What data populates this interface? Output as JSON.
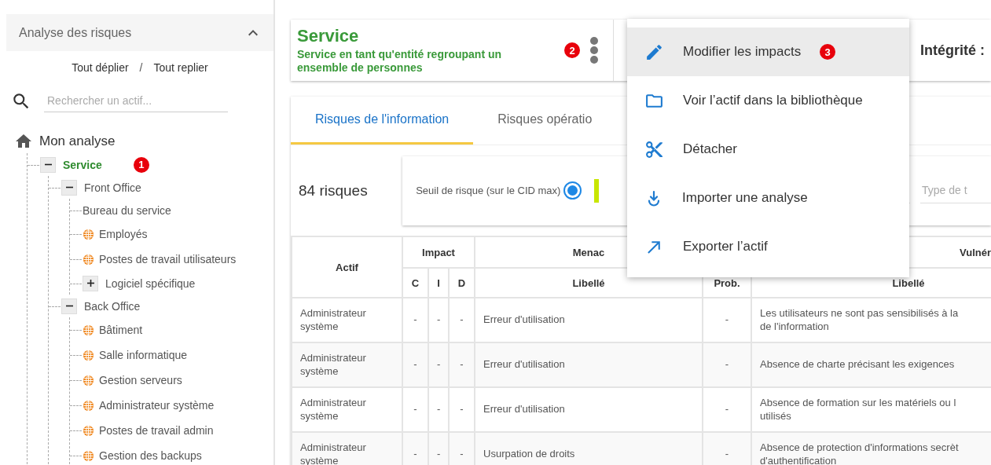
{
  "sidebar": {
    "title": "Analyse des risques",
    "expanded": true,
    "expand_all": "Tout déplier",
    "separator": "/",
    "collapse_all": "Tout replier",
    "search": {
      "placeholder": "Rechercher un actif..."
    },
    "tree": {
      "label": "Mon analyse",
      "children": [
        {
          "label": "Service",
          "kind": "group",
          "expanded": true,
          "selected": true,
          "badge": "1",
          "children": [
            {
              "label": "Front Office",
              "kind": "group",
              "expanded": true,
              "selected": false,
              "children": [
                {
                  "label": "Bureau du service",
                  "kind": "plain",
                  "selected": false
                },
                {
                  "label": "Employés",
                  "kind": "asset",
                  "selected": false
                },
                {
                  "label": "Postes de travail utilisateurs",
                  "kind": "asset",
                  "selected": false
                },
                {
                  "label": "Logiciel spécifique",
                  "kind": "group",
                  "expanded": false,
                  "selected": false
                }
              ]
            },
            {
              "label": "Back Office",
              "kind": "group",
              "expanded": true,
              "selected": false,
              "children": [
                {
                  "label": "Bâtiment",
                  "kind": "asset",
                  "selected": false
                },
                {
                  "label": "Salle informatique",
                  "kind": "asset",
                  "selected": false
                },
                {
                  "label": "Gestion serveurs",
                  "kind": "asset",
                  "selected": false
                },
                {
                  "label": "Administrateur système",
                  "kind": "asset",
                  "selected": false
                },
                {
                  "label": "Postes de travail admin",
                  "kind": "asset",
                  "selected": false
                },
                {
                  "label": "Gestion des backups",
                  "kind": "asset",
                  "selected": false
                }
              ]
            }
          ]
        }
      ]
    }
  },
  "asset_header": {
    "title": "Service",
    "subtitle": "Service en tant qu'entité regroupant un ensemble de personnes",
    "badge": "2",
    "integrity_label": "Intégrité :"
  },
  "tabs": [
    {
      "label": "Risques de l'information",
      "selected": true
    },
    {
      "label": "Risques opératio",
      "selected": false
    }
  ],
  "risk_count": "84 risques",
  "filters": {
    "threshold_label": "Seuil de risque (sur le CID max)",
    "threshold_radio_selected": true,
    "type_field": {
      "placeholder": "Type de t"
    }
  },
  "table": {
    "groups": [
      {
        "label": "Actif"
      },
      {
        "label": "Impact"
      },
      {
        "label": "Menac"
      },
      {
        "label": "Vulnér"
      }
    ],
    "subheaders": [
      "C",
      "I",
      "D",
      "Libellé",
      "Prob.",
      "Libellé"
    ],
    "rows": [
      {
        "asset": "Administrateur système",
        "c": "-",
        "i": "-",
        "d": "-",
        "threat": "Erreur d'utilisation",
        "prob": "-",
        "vulnerability": "Les utilisateurs ne sont pas sensibilisés à la\nde l'information"
      },
      {
        "asset": "Administrateur système",
        "c": "-",
        "i": "-",
        "d": "-",
        "threat": "Erreur d'utilisation",
        "prob": "-",
        "vulnerability": "Absence de charte précisant les exigences"
      },
      {
        "asset": "Administrateur système",
        "c": "-",
        "i": "-",
        "d": "-",
        "threat": "Erreur d'utilisation",
        "prob": "-",
        "vulnerability": "Absence de formation sur les matériels ou l\nutilisés"
      },
      {
        "asset": "Administrateur système",
        "c": "-",
        "i": "-",
        "d": "-",
        "threat": "Usurpation de droits",
        "prob": "-",
        "vulnerability": "Absence de protection d'informations secrèt\nd'authentification"
      }
    ]
  },
  "context_menu": {
    "items": [
      {
        "kind": "edit",
        "label": "Modifier les impacts",
        "selected": true,
        "badge": "3"
      },
      {
        "kind": "folder",
        "label": "Voir l’actif dans la bibliothèque",
        "selected": false
      },
      {
        "kind": "cut",
        "label": "Détacher",
        "selected": false
      },
      {
        "kind": "import",
        "label": "Importer une analyse",
        "selected": false
      },
      {
        "kind": "export",
        "label": "Exporter l’actif",
        "selected": false
      }
    ]
  }
}
